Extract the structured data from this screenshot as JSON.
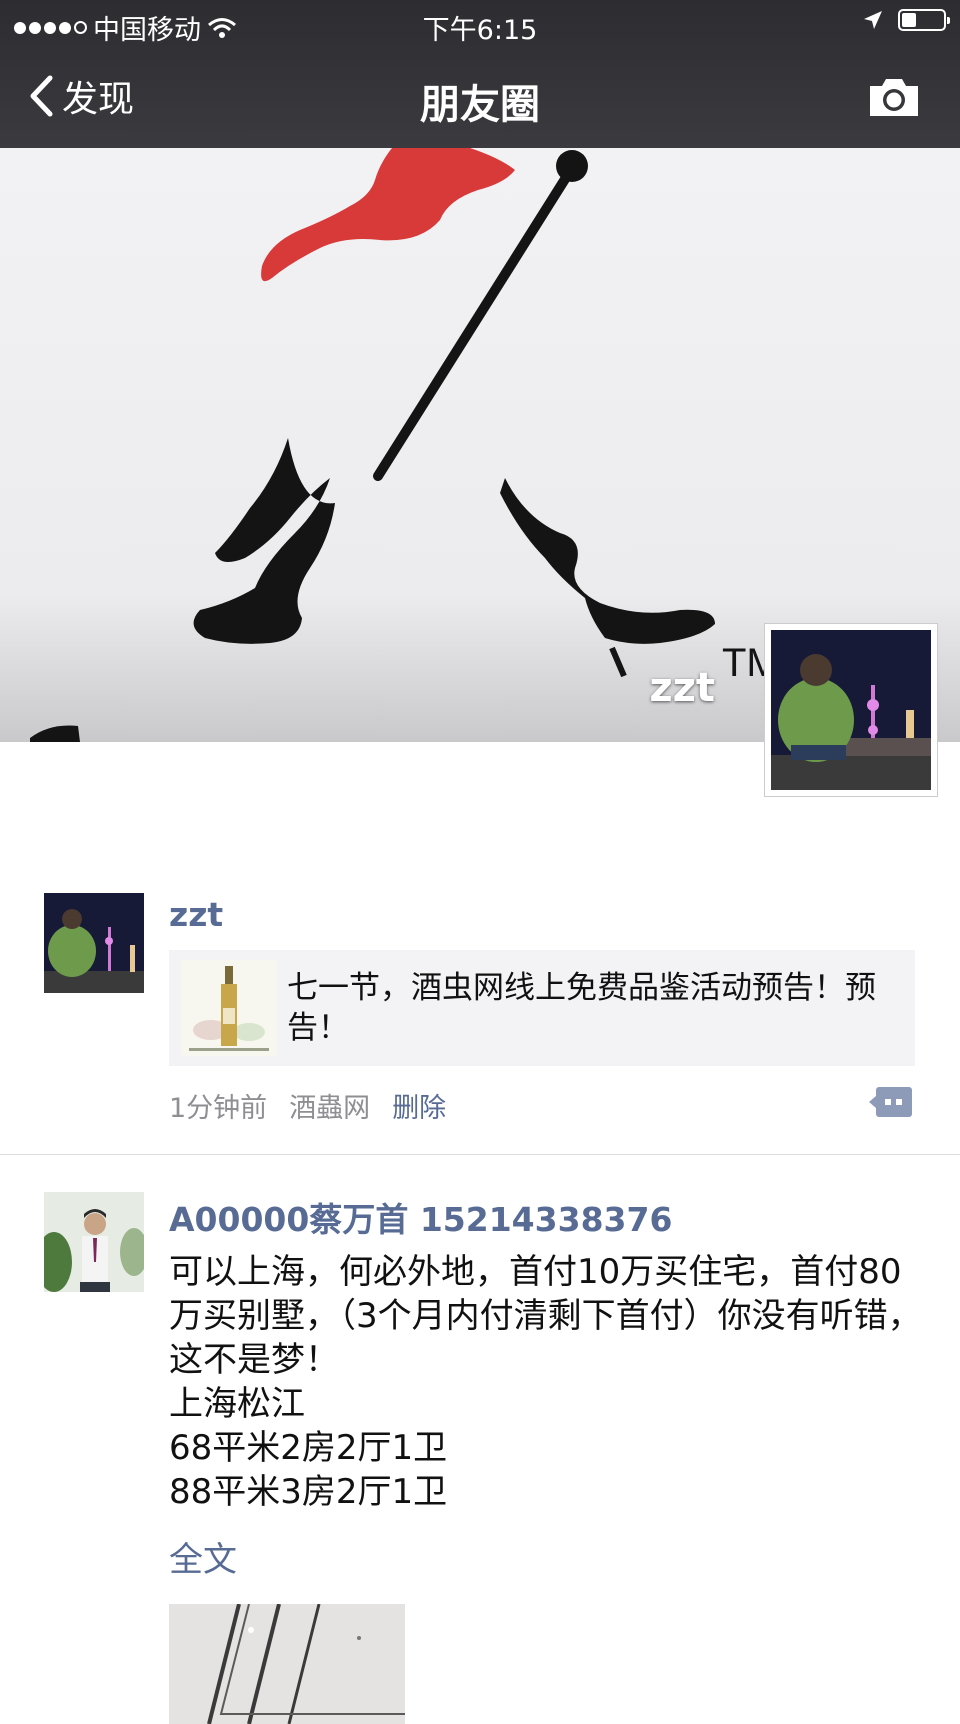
{
  "status_bar": {
    "carrier": "中国移动",
    "time": "下午6:15",
    "signal_bars": 4,
    "battery_level": 0.35,
    "icons": [
      "signal-dots-icon",
      "wifi-icon",
      "location-arrow-icon",
      "battery-icon"
    ]
  },
  "nav": {
    "back_label": "发现",
    "title": "朋友圈",
    "icons": [
      "chevron-left-icon",
      "camera-icon"
    ]
  },
  "cover": {
    "user_name": "zzt",
    "trademark": "TM"
  },
  "posts": [
    {
      "author": "zzt",
      "share_text": "七一节，酒虫网线上免费品鉴活动预告！预告！",
      "time": "1分钟前",
      "source": "酒蟲网",
      "delete_label": "删除"
    },
    {
      "author": "A00000蔡万首 15214338376",
      "body": "可以上海，何必外地，首付10万买住宅，首付80万买别墅，（3个月内付清剩下首付）你没有听错，这不是梦！\n上海松江\n68平米2房2厅1卫\n88平米3房2厅1卫",
      "more_label": "全文"
    }
  ],
  "colors": {
    "bar_background": "#37373b",
    "link_blue": "#576b95",
    "flag_red": "#d83a3a",
    "share_bg": "#f3f3f5"
  }
}
